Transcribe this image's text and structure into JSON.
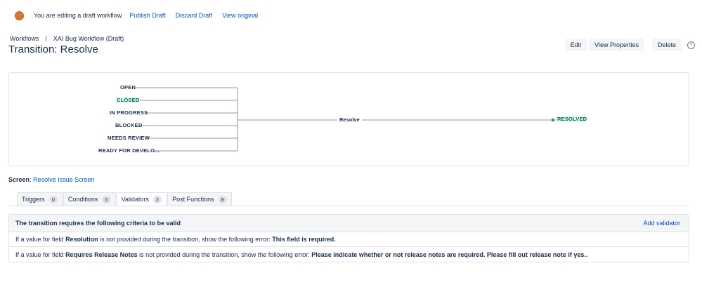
{
  "banner": {
    "message": "You are editing a draft workflow.",
    "publish": "Publish Draft",
    "discard": "Discard Draft",
    "view_original": "View original",
    "dot_color": "#d9772b"
  },
  "breadcrumb": {
    "workflows": "Workflows",
    "separator": "/",
    "current": "XAI Bug Workflow (Draft)"
  },
  "page_title": "Transition: Resolve",
  "actions": {
    "edit": "Edit",
    "view_properties": "View Properties",
    "delete": "Delete",
    "help_icon": "question-circle-icon"
  },
  "diagram": {
    "from_statuses": [
      "OPEN",
      "CLOSED",
      "IN PROGRESS",
      "BLOCKED",
      "NEEDS REVIEW",
      "READY FOR DEVELO..."
    ],
    "transition": "Resolve",
    "to_status": "RESOLVED"
  },
  "screen": {
    "label": "Screen",
    "colon": ":",
    "value": "Resolve Issue Screen"
  },
  "tabs": [
    {
      "label": "Triggers",
      "count": "0"
    },
    {
      "label": "Conditions",
      "count": "0"
    },
    {
      "label": "Validators",
      "count": "2"
    },
    {
      "label": "Post Functions",
      "count": "8"
    }
  ],
  "criteria": {
    "title": "The transition requires the following criteria to be valid",
    "add_link": "Add validator",
    "rows": [
      {
        "prefix": "If a value for field",
        "field": "Resolution",
        "middle": "is not provided during the transition, show the following error:",
        "error": "This field is required."
      },
      {
        "prefix": "If a value for field",
        "field": "Requires Release Notes",
        "middle": "is not provided during the transition, show the following error:",
        "error": "Please indicate whether or not release notes are required. Please fill out release note if yes.."
      }
    ]
  },
  "colors": {
    "link": "#0052cc",
    "text": "#172b4d",
    "resolved_text": "#006644",
    "resolved_bg": "#e3fcef"
  }
}
